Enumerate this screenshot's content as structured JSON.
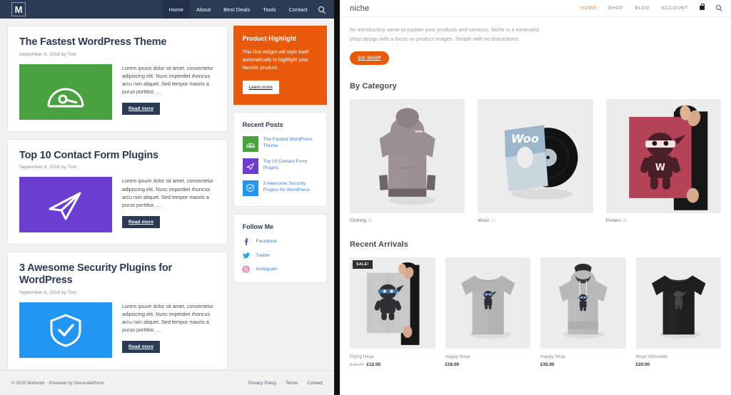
{
  "left_site": {
    "logo_letter": "M",
    "nav": [
      {
        "label": "Home",
        "active": true
      },
      {
        "label": "About",
        "active": false
      },
      {
        "label": "Best Deals",
        "active": false
      },
      {
        "label": "Tools",
        "active": false
      },
      {
        "label": "Contact",
        "active": false
      }
    ],
    "search_icon": "search-icon",
    "articles": [
      {
        "title": "The Fastest WordPress Theme",
        "meta": "September 8, 2018 by Tom",
        "excerpt": "Lorem ipsum dolor sit amet, consectetur adipiscing elit. Nunc imperdiet rhoncus arcu non aliquet. Sed tempor mauris a purus porttitor, …",
        "button": "Read more",
        "thumb_color": "#49a140",
        "thumb_icon": "speedometer-icon"
      },
      {
        "title": "Top 10 Contact Form Plugins",
        "meta": "September 8, 2018 by Tom",
        "excerpt": "Lorem ipsum dolor sit amet, consectetur adipiscing elit. Nunc imperdiet rhoncus arcu non aliquet. Sed tempor mauris a purus porttitor, …",
        "button": "Read more",
        "thumb_color": "#6c3ecf",
        "thumb_icon": "paper-plane-icon"
      },
      {
        "title": "3 Awesome Security Plugins for WordPress",
        "meta": "September 8, 2018 by Tom",
        "excerpt": "Lorem ipsum dolor sit amet, consectetur adipiscing elit. Nunc imperdiet rhoncus arcu non aliquet. Sed tempor mauris a purus porttitor, …",
        "button": "Read more",
        "thumb_color": "#2196f3",
        "thumb_icon": "shield-check-icon"
      }
    ],
    "highlight_widget": {
      "title": "Product Highlight",
      "body": "This first widget will style itself automatically to highlight your favorite product.",
      "button": "Learn more",
      "bg_color": "#e8590c"
    },
    "recent_posts": {
      "title": "Recent Posts",
      "items": [
        {
          "label": "The Fastest WordPress Theme",
          "color": "#49a140",
          "icon": "speedometer-icon"
        },
        {
          "label": "Top 10 Contact Form Plugins",
          "color": "#6c3ecf",
          "icon": "paper-plane-icon"
        },
        {
          "label": "3 Awesome Security Plugins for WordPress",
          "color": "#2196f3",
          "icon": "shield-check-icon"
        }
      ]
    },
    "follow_me": {
      "title": "Follow Me",
      "items": [
        {
          "label": "Facebook",
          "icon": "facebook-icon",
          "color": "#3b5998"
        },
        {
          "label": "Twitter",
          "icon": "twitter-icon",
          "color": "#1da1f2"
        },
        {
          "label": "Instagram",
          "icon": "instagram-icon",
          "color": "#e1306c"
        }
      ]
    },
    "footer": {
      "copyright": "© 2020 Marketer · Powered by GeneratePress",
      "links": [
        "Privacy Policy",
        "Terms",
        "Contact"
      ]
    },
    "accent_color": "#2b3a55"
  },
  "right_site": {
    "brand": "niche",
    "nav": [
      {
        "label": "HOME",
        "active": true
      },
      {
        "label": "SHOP",
        "active": false
      },
      {
        "label": "BLOG",
        "active": false
      },
      {
        "label": "ACCOUNT",
        "active": false
      }
    ],
    "cart_icon": "shopping-bag-icon",
    "search_icon": "search-icon",
    "intro": "An introductory verse to explain your products and services. Niche is a minimalist shop design with a focus on product images. Simple with no distractions.",
    "cta": "GO SHOP",
    "accent_color": "#e8590c",
    "category_section": {
      "title": "By Category",
      "items": [
        {
          "label": "Clothing",
          "count": "(6)",
          "image": "grey-hoodie-photo"
        },
        {
          "label": "Music",
          "count": "(7)",
          "image": "woo-vinyl-record-photo"
        },
        {
          "label": "Posters",
          "count": "(5)",
          "image": "red-ninja-poster-photo"
        }
      ]
    },
    "arrivals_section": {
      "title": "Recent Arrivals",
      "items": [
        {
          "name": "Flying Ninja",
          "price": "£12.00",
          "old_price": "£15.00",
          "badge": "SALE!",
          "image": "ninja-poster-photo"
        },
        {
          "name": "Happy Ninja",
          "price": "£18.00",
          "old_price": "",
          "badge": "",
          "image": "grey-tshirt-photo"
        },
        {
          "name": "Happy Ninja",
          "price": "£35.00",
          "old_price": "",
          "badge": "",
          "image": "grey-hoodie-photo"
        },
        {
          "name": "Ninja Silhouette",
          "price": "£20.00",
          "old_price": "",
          "badge": "",
          "image": "black-tshirt-photo"
        }
      ]
    }
  }
}
